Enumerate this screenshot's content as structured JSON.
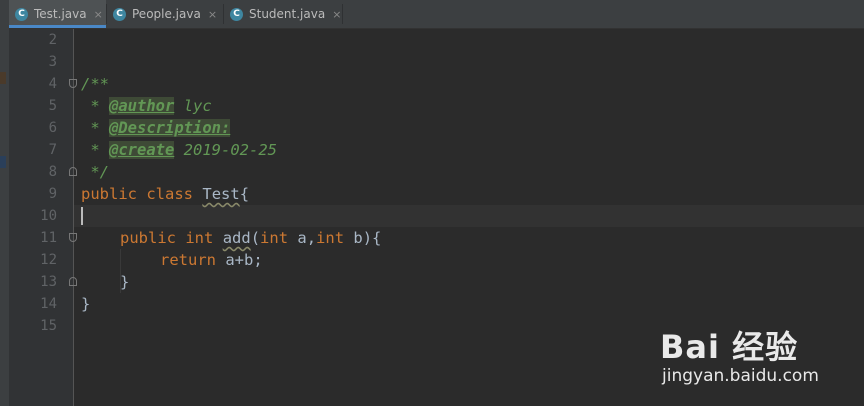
{
  "tabs": [
    {
      "label": "Test.java",
      "icon": "class-icon",
      "icon_letter": "C",
      "active": true
    },
    {
      "label": "People.java",
      "icon": "class-icon",
      "icon_letter": "C",
      "active": false
    },
    {
      "label": "Student.java",
      "icon": "class-icon",
      "icon_letter": "C",
      "active": false
    }
  ],
  "close_glyph": "×",
  "line_numbers": [
    "2",
    "3",
    "4",
    "5",
    "6",
    "7",
    "8",
    "9",
    "10",
    "11",
    "12",
    "13",
    "14",
    "15"
  ],
  "code": {
    "l4_open": "/**",
    "l5_star": " * ",
    "l5_tag": "@author",
    "l5_text": " lyc",
    "l6_star": " * ",
    "l6_tag": "@Description:",
    "l7_star": " * ",
    "l7_tag": "@create",
    "l7_text": " 2019-02-25",
    "l8_close": " */",
    "l9_kw1": "public",
    "l9_kw2": "class",
    "l9_name": "Test",
    "l9_brace": "{",
    "l11_kw1": "public",
    "l11_kw2": "int",
    "l11_name": "add",
    "l11_paren": "(",
    "l11_kw3": "int",
    "l11_mid": " a,",
    "l11_kw4": "int",
    "l11_end": " b){",
    "l12_kw": "return",
    "l12_expr": " a+b;",
    "l13_brace": "}",
    "l14_brace": "}"
  },
  "watermark": {
    "brand": "Bai 经验",
    "url": "jingyan.baidu.com"
  },
  "colors": {
    "editor_bg": "#2b2b2b",
    "keyword": "#cc7832",
    "comment": "#629755",
    "text": "#a9b7c6",
    "line_number": "#606366"
  }
}
